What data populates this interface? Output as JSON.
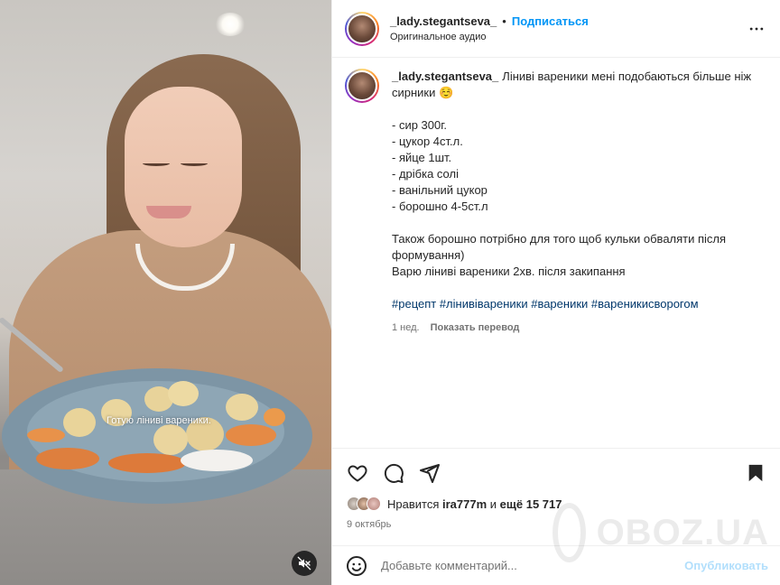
{
  "video": {
    "overlay_caption": "Готую ліниві вареники.",
    "mute_icon": "speaker-muted-icon"
  },
  "header": {
    "username": "_lady.stegantseva_",
    "separator": "•",
    "follow_label": "Подписаться",
    "audio_label": "Оригинальное аудио",
    "more_icon": "more-horizontal-icon"
  },
  "caption": {
    "username": "_lady.stegantseva_",
    "intro": "Ліниві вареники мені подобаються більше ніж сирники ☺️",
    "ingredients": [
      "- сир 300г.",
      "- цукор 4ст.л.",
      "- яйце 1шт.",
      "- дрібка солі",
      "- ванільний цукор",
      "- борошно 4-5ст.л"
    ],
    "note1": "Також борошно потрібно для того щоб кульки обваляти після формування)",
    "note2": "Варю ліниві вареники 2хв. після закипання",
    "hashtags": "#рецепт #лінивівареники #вареники #вареникисворогом",
    "time_ago": "1 нед.",
    "translate_label": "Показать перевод"
  },
  "actions": {
    "like_icon": "heart-icon",
    "comment_icon": "comment-bubble-icon",
    "share_icon": "send-icon",
    "save_icon": "bookmark-icon"
  },
  "likes": {
    "prefix": "Нравится",
    "user": "ira777m",
    "middle": "и",
    "count_text": "ещё 15 717"
  },
  "date": "9 октябрь",
  "add_comment": {
    "emoji_icon": "smiley-icon",
    "placeholder": "Добавьте комментарий...",
    "publish_label": "Опубликовать"
  },
  "watermark": "OBOZ.UA",
  "colors": {
    "accent": "#0095f6",
    "hashtag": "#00376b",
    "publish_disabled": "#b2dffc",
    "secondary_text": "#737373"
  }
}
